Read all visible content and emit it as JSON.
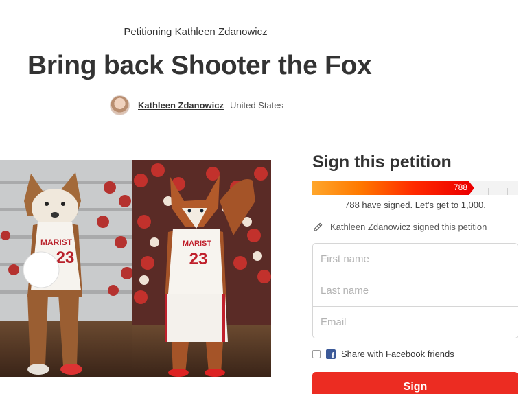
{
  "header": {
    "petitioning_prefix": "Petitioning",
    "target_name": "Kathleen Zdanowicz",
    "title": "Bring back Shooter the Fox"
  },
  "author": {
    "name": "Kathleen Zdanowicz",
    "location": "United States"
  },
  "sign_panel": {
    "title": "Sign this petition",
    "progress": {
      "count_label": "788",
      "signed": 788,
      "goal": 1000
    },
    "signed_text": "788 have signed. Let’s get to 1,000.",
    "recent_signer_text": "Kathleen Zdanowicz signed this petition",
    "fields": {
      "first_name_placeholder": "First name",
      "last_name_placeholder": "Last name",
      "email_placeholder": "Email"
    },
    "share_label": "Share with Facebook friends",
    "sign_button_label": "Sign"
  },
  "photo": {
    "left_jersey_text": "MARIST",
    "left_number": "23",
    "right_jersey_text": "MARIST",
    "right_number": "23"
  },
  "colors": {
    "accent_red": "#ec2c22",
    "progress_start": "#ffa62b",
    "progress_end": "#ec0000",
    "facebook_blue": "#3b5998"
  },
  "icons": [
    "pencil-icon",
    "facebook-icon",
    "avatar"
  ]
}
